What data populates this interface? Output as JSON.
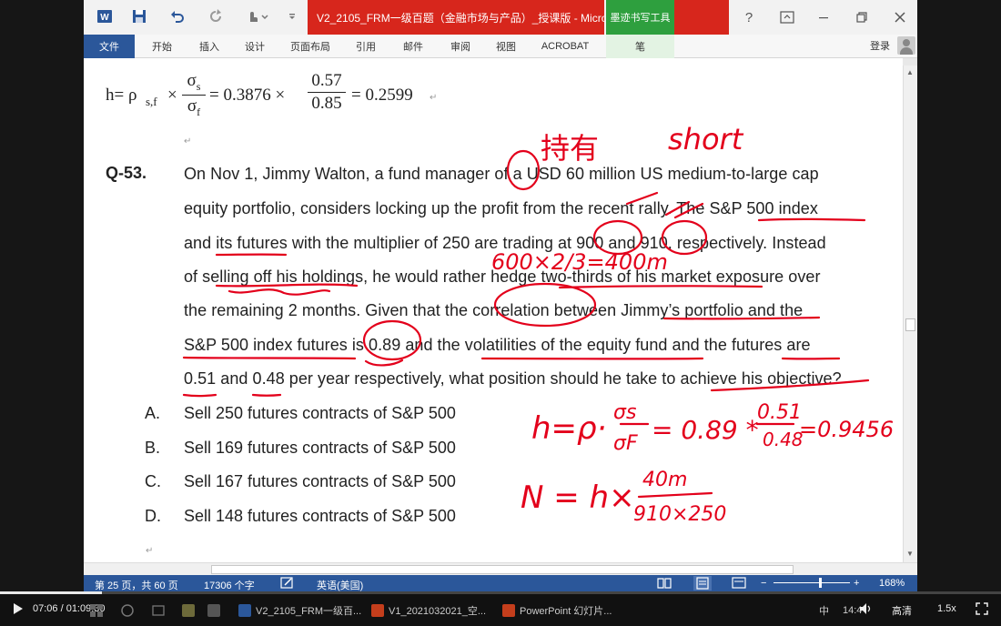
{
  "window": {
    "doc_title": "V2_2105_FRM一级百题（金融市场与产品）_授课版 - Micro...",
    "ink_tools_title": "墨迹书写工具",
    "help": "?",
    "signin": "登录"
  },
  "ribbon": {
    "tabs": [
      "文件",
      "开始",
      "插入",
      "设计",
      "页面布局",
      "引用",
      "邮件",
      "审阅",
      "视图",
      "ACROBAT",
      "笔"
    ]
  },
  "document": {
    "formula": {
      "lhs": "h= ρ",
      "sub": "s,f",
      "times1": "×",
      "frac1_num": "σ",
      "frac1_num_sub": "s",
      "frac1_den": "σ",
      "frac1_den_sub": "f",
      "eq1": "= 0.3876 ×",
      "frac2_num": "0.57",
      "frac2_den": "0.85",
      "result": "= 0.2599"
    },
    "question_number": "Q-53.",
    "question_lines": [
      "On Nov 1, Jimmy Walton, a fund manager of a USD 60 million US medium-to-large cap",
      "equity portfolio, considers locking up the profit from the recent rally. The S&P 500 index",
      "and its futures with the multiplier of 250 are trading at 900 and 910, respectively. Instead",
      "of selling off his holdings, he would rather hedge two-thirds of his market exposure over",
      "the remaining 2 months. Given that the correlation between Jimmy’s portfolio and the",
      "S&P 500 index futures is 0.89 and the volatilities of the equity fund and the futures are",
      "0.51 and 0.48 per year respectively, what position should he take to achieve his objective?"
    ],
    "options": [
      {
        "letter": "A.",
        "text": "Sell 250 futures contracts of S&P 500"
      },
      {
        "letter": "B.",
        "text": "Sell 169 futures contracts of S&P 500"
      },
      {
        "letter": "C.",
        "text": "Sell 167 futures contracts of S&P 500"
      },
      {
        "letter": "D.",
        "text": "Sell 148 futures contracts of S&P 500"
      }
    ],
    "pilcrow": "↵"
  },
  "annotations": {
    "chinese_note": "持有",
    "short_note": "short",
    "calc1": "600×2/3=400m",
    "hedge_ratio_h": "h=ρ·",
    "hedge_sigma_s": "σs",
    "hedge_sigma_f": "σF",
    "hedge_mid": "= 0.89 *",
    "hedge_num": "0.51",
    "hedge_den": "0.48",
    "hedge_result": "=0.9456",
    "n_formula": "N = h×",
    "n_num": "40m",
    "n_den": "910×250",
    "ink_color": "#e3001b"
  },
  "statusbar": {
    "page": "第 25 页，共 60 页",
    "words": "17306 个字",
    "language": "英语(美国)",
    "zoom": "168%"
  },
  "player": {
    "time": "07:06 / 01:09:30",
    "progress": 0.102,
    "quality": "高清",
    "speed": "1.5x",
    "taskbar": [
      "V2_2105_FRM一级百...",
      "V1_2021032021_空...",
      "PowerPoint 幻灯片..."
    ],
    "ime": "中",
    "clock": "14:4"
  }
}
